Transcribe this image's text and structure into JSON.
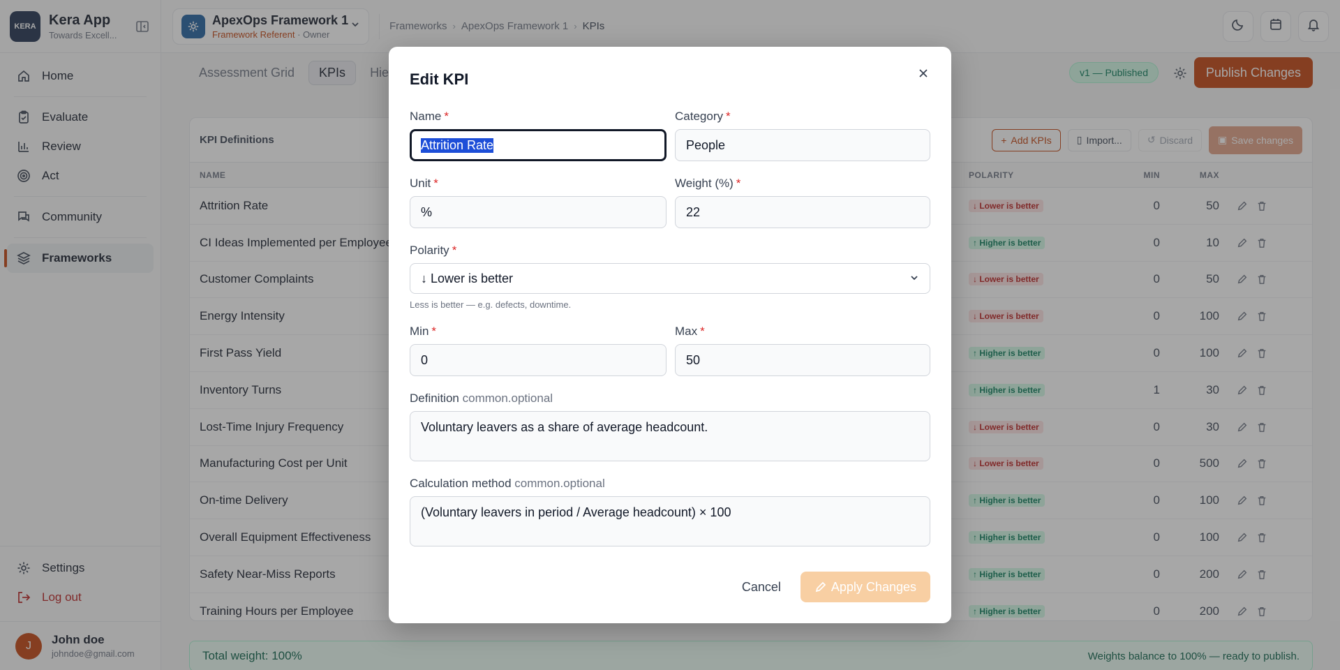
{
  "app": {
    "name": "Kera App",
    "tagline": "Towards Excell...",
    "logo_text": "KERA"
  },
  "sidebar": {
    "items": [
      {
        "label": "Home",
        "icon": "home-icon"
      },
      {
        "label": "Evaluate",
        "icon": "clipboard-icon"
      },
      {
        "label": "Review",
        "icon": "bar-chart-icon"
      },
      {
        "label": "Act",
        "icon": "target-icon"
      },
      {
        "label": "Community",
        "icon": "chat-icon"
      },
      {
        "label": "Frameworks",
        "icon": "layers-icon",
        "active": true
      }
    ],
    "settings": "Settings",
    "logout": "Log out"
  },
  "user": {
    "name": "John doe",
    "email": "johndoe@gmail.com",
    "initial": "J"
  },
  "framework": {
    "name": "ApexOps Framework 1",
    "role": "Framework Referent",
    "owner": " · Owner"
  },
  "breadcrumb": [
    "Frameworks",
    "ApexOps Framework 1",
    "KPIs"
  ],
  "tabs": [
    "Assessment Grid",
    "KPIs",
    "Hier"
  ],
  "status": "v1 — Published",
  "publish_label": "Publish Changes",
  "card": {
    "title": "KPI Definitions",
    "add": "Add KPIs",
    "import": "Import...",
    "discard": "Discard",
    "save": "Save changes",
    "columns": {
      "name": "NAME",
      "polarity": "POLARITY",
      "min": "MIN",
      "max": "MAX"
    },
    "rows": [
      {
        "name": "Attrition Rate",
        "polarity": "Lower is better",
        "min": "0",
        "max": "50"
      },
      {
        "name": "CI Ideas Implemented per Employee",
        "polarity": "Higher is better",
        "min": "0",
        "max": "10"
      },
      {
        "name": "Customer Complaints",
        "polarity": "Lower is better",
        "min": "0",
        "max": "50"
      },
      {
        "name": "Energy Intensity",
        "polarity": "Lower is better",
        "min": "0",
        "max": "100"
      },
      {
        "name": "First Pass Yield",
        "polarity": "Higher is better",
        "min": "0",
        "max": "100"
      },
      {
        "name": "Inventory Turns",
        "polarity": "Higher is better",
        "min": "1",
        "max": "30"
      },
      {
        "name": "Lost-Time Injury Frequency",
        "polarity": "Lower is better",
        "min": "0",
        "max": "30"
      },
      {
        "name": "Manufacturing Cost per Unit",
        "polarity": "Lower is better",
        "min": "0",
        "max": "500"
      },
      {
        "name": "On-time Delivery",
        "polarity": "Higher is better",
        "min": "0",
        "max": "100"
      },
      {
        "name": "Overall Equipment Effectiveness",
        "polarity": "Higher is better",
        "min": "0",
        "max": "100"
      },
      {
        "name": "Safety Near-Miss Reports",
        "polarity": "Higher is better",
        "min": "0",
        "max": "200"
      },
      {
        "name": "Training Hours per Employee",
        "polarity": "Higher is better",
        "min": "0",
        "max": "200"
      }
    ]
  },
  "footer": {
    "total": "Total weight: 100%",
    "balance": "Weights balance to 100% — ready to publish."
  },
  "modal": {
    "title": "Edit KPI",
    "name_label": "Name",
    "name_value": "Attrition Rate",
    "category_label": "Category",
    "category_value": "People",
    "unit_label": "Unit",
    "unit_value": "%",
    "weight_label": "Weight (%)",
    "weight_value": "22",
    "polarity_label": "Polarity",
    "polarity_value": "↓ Lower is better",
    "polarity_hint": "Less is better — e.g. defects, downtime.",
    "min_label": "Min",
    "min_value": "0",
    "max_label": "Max",
    "max_value": "50",
    "definition_label": "Definition",
    "optional": "common.optional",
    "definition_value": "Voluntary leavers as a share of average headcount.",
    "calc_label": "Calculation method",
    "calc_value": "(Voluntary leavers in period / Average headcount) × 100",
    "cancel": "Cancel",
    "apply": "Apply Changes"
  },
  "required_mark": "*"
}
